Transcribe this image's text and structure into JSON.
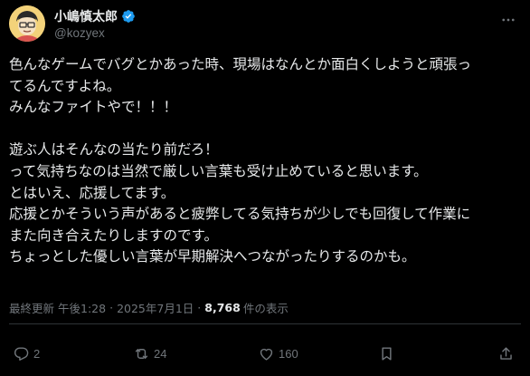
{
  "user": {
    "display_name": "小嶋慎太郎",
    "handle": "@kozyex"
  },
  "tweet": {
    "lines": [
      "色んなゲームでバグとかあった時、現場はなんとか面白くしようと頑張っ",
      "てるんですよね。",
      "みんなファイトやで！！！",
      "",
      "遊ぶ人はそんなの当たり前だろ！",
      "って気持ちなのは当然で厳しい言葉も受け止めていると思います。",
      "とはいえ、応援してます。",
      "応援とかそういう声があると疲弊してる気持ちが少しでも回復して作業に",
      "また向き合えたりしますのです。",
      "ちょっとした優しい言葉が早期解決へつながったりするのかも。"
    ]
  },
  "meta": {
    "updated_prefix": "最終更新",
    "time": "午後1:28",
    "separator": "·",
    "date": "2025年7月1日",
    "views_count": "8,768",
    "views_label": "件の表示"
  },
  "actions": {
    "reply_count": "2",
    "retweet_count": "24",
    "like_count": "160"
  },
  "colors": {
    "background": "#000000",
    "text": "#e7e9ea",
    "muted": "#71767b",
    "verified": "#1d9bf0",
    "divider": "#2f3336"
  },
  "icons": {
    "more": "more-dots-icon",
    "verified": "verified-badge-icon",
    "reply": "reply-icon",
    "retweet": "retweet-icon",
    "like": "heart-icon",
    "bookmark": "bookmark-icon",
    "share": "share-icon"
  }
}
